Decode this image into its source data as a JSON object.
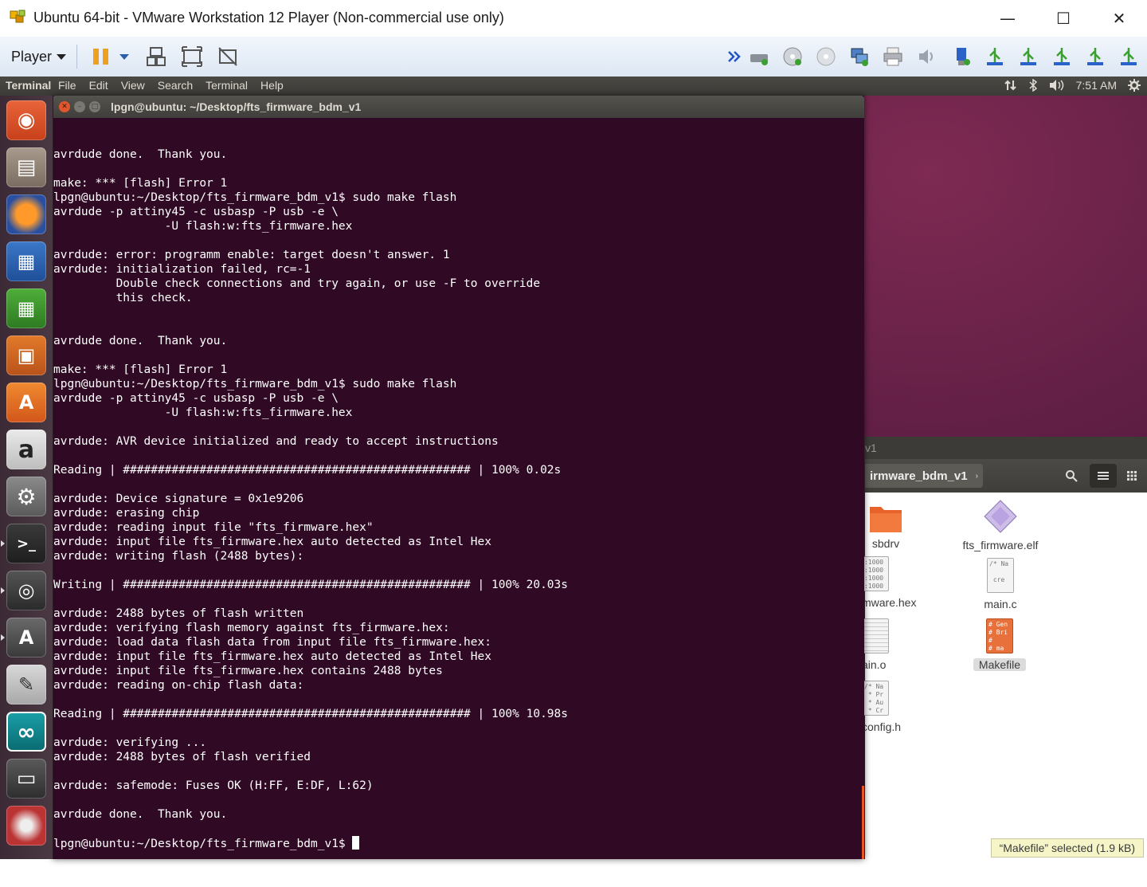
{
  "window": {
    "title": "Ubuntu 64-bit - VMware Workstation 12 Player (Non-commercial use only)",
    "minimize": "—",
    "maximize": "☐",
    "close": "✕"
  },
  "toolbar": {
    "player_label": "Player"
  },
  "panel": {
    "app_name": "Terminal",
    "menus": [
      "File",
      "Edit",
      "View",
      "Search",
      "Terminal",
      "Help"
    ],
    "time": "7:51 AM"
  },
  "launcher": {
    "items": [
      "ubuntu-dash",
      "files",
      "firefox",
      "libreoffice-writer",
      "libreoffice-calc",
      "libreoffice-impress",
      "ubuntu-software",
      "amazon",
      "system-settings",
      "terminal",
      "disk-utility",
      "software-updater",
      "text-editor",
      "arduino",
      "save-floppy",
      "dvd"
    ]
  },
  "terminal": {
    "title": "lpgn@ubuntu: ~/Desktop/fts_firmware_bdm_v1",
    "lines": [
      "avrdude done.  Thank you.",
      "",
      "make: *** [flash] Error 1",
      "lpgn@ubuntu:~/Desktop/fts_firmware_bdm_v1$ sudo make flash",
      "avrdude -p attiny45 -c usbasp -P usb -e \\",
      "                -U flash:w:fts_firmware.hex",
      "",
      "avrdude: error: programm enable: target doesn't answer. 1",
      "avrdude: initialization failed, rc=-1",
      "         Double check connections and try again, or use -F to override",
      "         this check.",
      "",
      "",
      "avrdude done.  Thank you.",
      "",
      "make: *** [flash] Error 1",
      "lpgn@ubuntu:~/Desktop/fts_firmware_bdm_v1$ sudo make flash",
      "avrdude -p attiny45 -c usbasp -P usb -e \\",
      "                -U flash:w:fts_firmware.hex",
      "",
      "avrdude: AVR device initialized and ready to accept instructions",
      "",
      "Reading | ################################################## | 100% 0.02s",
      "",
      "avrdude: Device signature = 0x1e9206",
      "avrdude: erasing chip",
      "avrdude: reading input file \"fts_firmware.hex\"",
      "avrdude: input file fts_firmware.hex auto detected as Intel Hex",
      "avrdude: writing flash (2488 bytes):",
      "",
      "Writing | ################################################## | 100% 20.03s",
      "",
      "avrdude: 2488 bytes of flash written",
      "avrdude: verifying flash memory against fts_firmware.hex:",
      "avrdude: load data flash data from input file fts_firmware.hex:",
      "avrdude: input file fts_firmware.hex auto detected as Intel Hex",
      "avrdude: input file fts_firmware.hex contains 2488 bytes",
      "avrdude: reading on-chip flash data:",
      "",
      "Reading | ################################################## | 100% 10.98s",
      "",
      "avrdude: verifying ...",
      "avrdude: 2488 bytes of flash verified",
      "",
      "avrdude: safemode: Fuses OK (H:FF, E:DF, L:62)",
      "",
      "avrdude done.  Thank you.",
      ""
    ],
    "prompt": "lpgn@ubuntu:~/Desktop/fts_firmware_bdm_v1$ "
  },
  "files": {
    "window_title_fragment": "v1",
    "path_fragment": "irmware_bdm_v1",
    "items": [
      {
        "label": "sbdrv",
        "type": "folder"
      },
      {
        "label": "fts_firmware.elf",
        "type": "elf"
      },
      {
        "label": "mware.hex",
        "type": "hex",
        "preview": ":1000\n:1000\n:1000\n:1000"
      },
      {
        "label": "main.c",
        "type": "c",
        "preview": "/* Na\n\n cre"
      },
      {
        "label": "ain.o",
        "type": "object"
      },
      {
        "label": "Makefile",
        "type": "makefile",
        "preview": "# Gen\n# Bri\n#\n# ma"
      },
      {
        "label": "config.h",
        "type": "header",
        "preview": "/* Na\n * Pr\n * Au\n * Cr"
      }
    ],
    "status": "“Makefile” selected  (1.9 kB)"
  },
  "colors": {
    "terminal_bg": "#300a24",
    "ubuntu_orange": "#e95420",
    "panel_bg": "#3c3b37"
  }
}
